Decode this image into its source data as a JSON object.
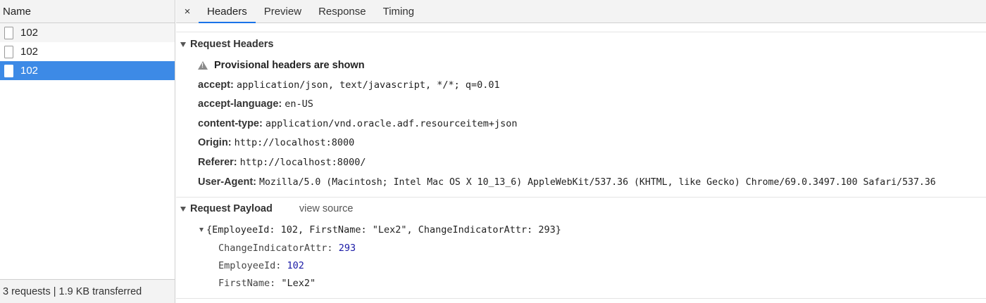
{
  "left": {
    "header": "Name",
    "requests": [
      {
        "label": "102",
        "selected": false
      },
      {
        "label": "102",
        "selected": false
      },
      {
        "label": "102",
        "selected": true
      }
    ],
    "footer": "3 requests | 1.9 KB transferred"
  },
  "tabs": {
    "close": "×",
    "items": [
      "Headers",
      "Preview",
      "Response",
      "Timing"
    ],
    "active": "Headers"
  },
  "request_headers": {
    "title": "Request Headers",
    "warning": "Provisional headers are shown",
    "rows": [
      {
        "key": "accept:",
        "value": "application/json, text/javascript, */*; q=0.01"
      },
      {
        "key": "accept-language:",
        "value": "en-US"
      },
      {
        "key": "content-type:",
        "value": "application/vnd.oracle.adf.resourceitem+json"
      },
      {
        "key": "Origin:",
        "value": "http://localhost:8000"
      },
      {
        "key": "Referer:",
        "value": "http://localhost:8000/"
      },
      {
        "key": "User-Agent:",
        "value": "Mozilla/5.0 (Macintosh; Intel Mac OS X 10_13_6) AppleWebKit/537.36 (KHTML, like Gecko) Chrome/69.0.3497.100 Safari/537.36"
      }
    ]
  },
  "payload": {
    "title": "Request Payload",
    "view_source": "view source",
    "summary": "{EmployeeId: 102, FirstName: \"Lex2\", ChangeIndicatorAttr: 293}",
    "rows": [
      {
        "key": "ChangeIndicatorAttr:",
        "value": "293"
      },
      {
        "key": "EmployeeId:",
        "value": "102"
      },
      {
        "key": "FirstName:",
        "value": "\"Lex2\""
      }
    ]
  }
}
